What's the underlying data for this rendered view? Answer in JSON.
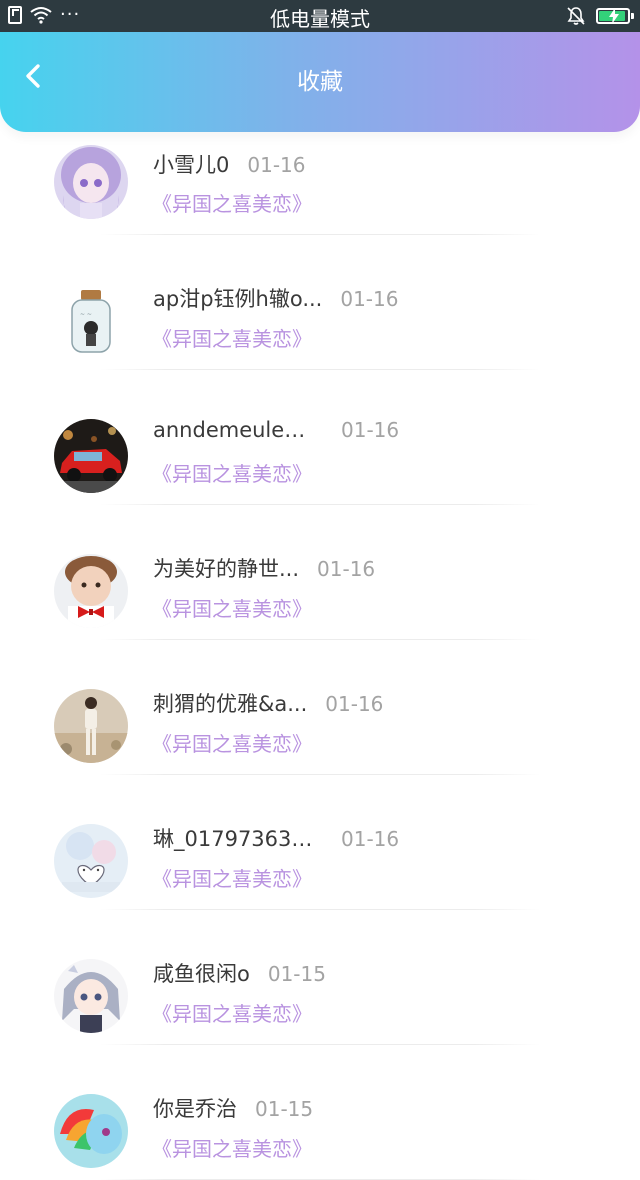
{
  "status_bar": {
    "mode_text": "低电量模式",
    "dots": "···"
  },
  "header": {
    "title": "收藏",
    "accent_start": "#46d3ee",
    "accent_end": "#b492e9"
  },
  "items": [
    {
      "name": "小雪儿0",
      "date": "01-16",
      "book": "《异国之喜美恋》",
      "avatar_icon": "anime-girl-purple-hair-avatar"
    },
    {
      "name": "ap泔p钰例h辙o...",
      "date": "01-16",
      "book": "《异国之喜美恋》",
      "avatar_icon": "jar-doll-avatar"
    },
    {
      "name": "anndemeuleme...",
      "date": "01-16",
      "book": "《异国之喜美恋》",
      "avatar_icon": "red-car-avatar"
    },
    {
      "name": "为美好的静世...",
      "date": "01-16",
      "book": "《异国之喜美恋》",
      "avatar_icon": "child-bowtie-avatar"
    },
    {
      "name": "刺猬的优雅&a...",
      "date": "01-16",
      "book": "《异国之喜美恋》",
      "avatar_icon": "person-desert-avatar"
    },
    {
      "name": "琳_017973635...",
      "date": "01-16",
      "book": "《异国之喜美恋》",
      "avatar_icon": "pastel-heart-avatar"
    },
    {
      "name": "咸鱼很闲o",
      "date": "01-15",
      "book": "《异国之喜美恋》",
      "avatar_icon": "anime-girl-gray-hair-avatar"
    },
    {
      "name": "你是乔治",
      "date": "01-15",
      "book": "《异国之喜美恋》",
      "avatar_icon": "rainbow-pony-avatar"
    }
  ]
}
